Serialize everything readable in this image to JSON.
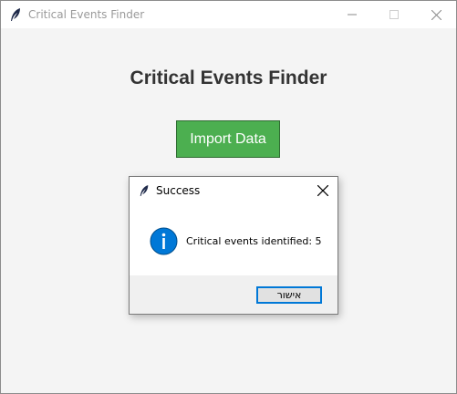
{
  "window": {
    "title": "Critical Events Finder",
    "icon": "feather-icon"
  },
  "main": {
    "heading": "Critical Events Finder",
    "import_button_label": "Import Data"
  },
  "dialog": {
    "title": "Success",
    "icon": "info-icon",
    "message": "Critical events identified: 5",
    "ok_label": "אישור"
  },
  "colors": {
    "button_green": "#4caf50",
    "info_blue": "#0078d7",
    "heading_text": "#333333"
  }
}
